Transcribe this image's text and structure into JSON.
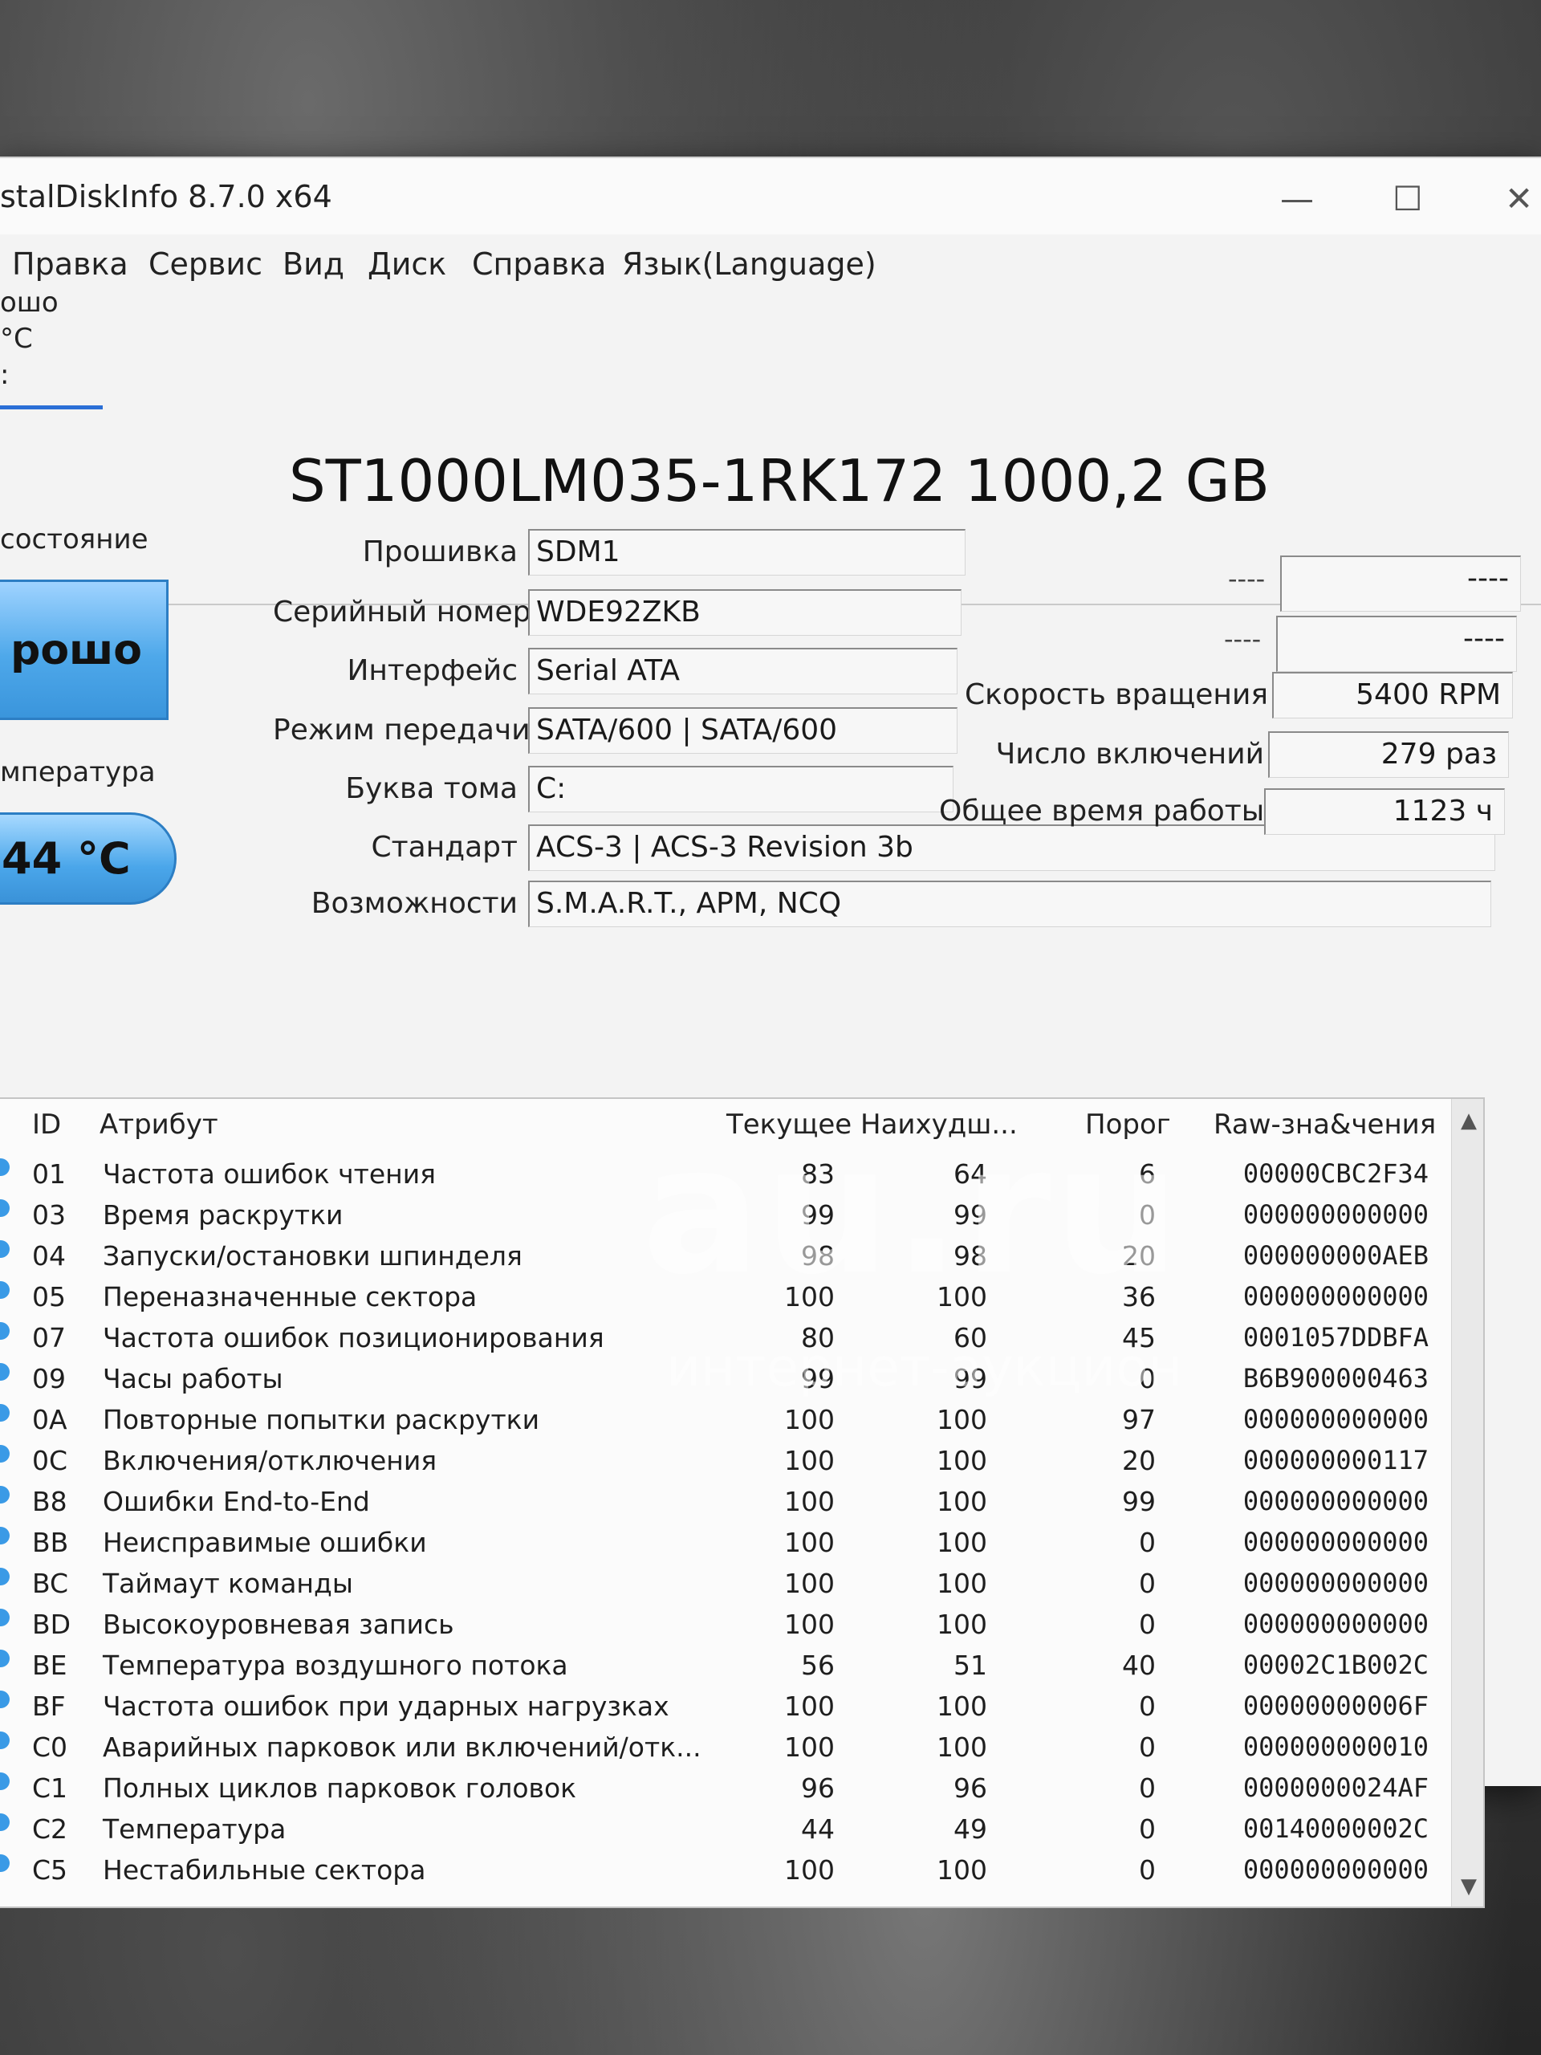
{
  "window": {
    "title": "stalDiskInfo 8.7.0 x64",
    "minimize": "—",
    "maximize": "☐",
    "close": "✕"
  },
  "menu": [
    "Правка",
    "Сервис",
    "Вид",
    "Диск",
    "Справка",
    "Язык(Language)"
  ],
  "left_panel": {
    "tab_line1": "ошо",
    "tab_line2": "°C",
    "tab_line3": ":",
    "health_label": "состояние",
    "health_value": "рошо",
    "temp_label": "мпература",
    "temp_value": "44 °C"
  },
  "disk": {
    "model": "ST1000LM035-1RK172 1000,2 GB",
    "firmware_label": "Прошивка",
    "firmware": "SDM1",
    "serial_label": "Серийный номер",
    "serial": "WDE92ZKB",
    "interface_label": "Интерфейс",
    "interface": "Serial ATA",
    "transfer_label": "Режим передачи",
    "transfer": "SATA/600 | SATA/600",
    "drive_letter_label": "Буква тома",
    "drive_letter": "C:",
    "standard_label": "Стандарт",
    "standard": "ACS-3 | ACS-3 Revision 3b",
    "features_label": "Возможности",
    "features": "S.M.A.R.T., APM, NCQ",
    "blank1_left": "----",
    "blank1_right": "----",
    "blank2_left": "----",
    "blank2_right": "----",
    "rotation_label": "Скорость вращения",
    "rotation": "5400 RPM",
    "power_count_label": "Число включений",
    "power_count": "279 раз",
    "power_hours_label": "Общее время работы",
    "power_hours": "1123 ч"
  },
  "table": {
    "headers": {
      "id": "ID",
      "attr": "Атрибут",
      "current": "Текущее",
      "worst": "Наихудш...",
      "threshold": "Порог",
      "raw": "Raw-зна&чения"
    },
    "rows": [
      {
        "id": "01",
        "name": "Частота ошибок чтения",
        "current": "83",
        "worst": "64",
        "threshold": "6",
        "raw": "00000CBC2F34"
      },
      {
        "id": "03",
        "name": "Время раскрутки",
        "current": "99",
        "worst": "99",
        "threshold": "0",
        "raw": "000000000000"
      },
      {
        "id": "04",
        "name": "Запуски/остановки шпинделя",
        "current": "98",
        "worst": "98",
        "threshold": "20",
        "raw": "000000000AEB"
      },
      {
        "id": "05",
        "name": "Переназначенные сектора",
        "current": "100",
        "worst": "100",
        "threshold": "36",
        "raw": "000000000000"
      },
      {
        "id": "07",
        "name": "Частота ошибок позиционирования",
        "current": "80",
        "worst": "60",
        "threshold": "45",
        "raw": "0001057DDBFA"
      },
      {
        "id": "09",
        "name": "Часы работы",
        "current": "99",
        "worst": "99",
        "threshold": "0",
        "raw": "B6B900000463"
      },
      {
        "id": "0A",
        "name": "Повторные попытки раскрутки",
        "current": "100",
        "worst": "100",
        "threshold": "97",
        "raw": "000000000000"
      },
      {
        "id": "0C",
        "name": "Включения/отключения",
        "current": "100",
        "worst": "100",
        "threshold": "20",
        "raw": "000000000117"
      },
      {
        "id": "B8",
        "name": "Ошибки End-to-End",
        "current": "100",
        "worst": "100",
        "threshold": "99",
        "raw": "000000000000"
      },
      {
        "id": "BB",
        "name": "Неисправимые ошибки",
        "current": "100",
        "worst": "100",
        "threshold": "0",
        "raw": "000000000000"
      },
      {
        "id": "BC",
        "name": "Таймаут команды",
        "current": "100",
        "worst": "100",
        "threshold": "0",
        "raw": "000000000000"
      },
      {
        "id": "BD",
        "name": "Высокоуровневая запись",
        "current": "100",
        "worst": "100",
        "threshold": "0",
        "raw": "000000000000"
      },
      {
        "id": "BE",
        "name": "Температура воздушного потока",
        "current": "56",
        "worst": "51",
        "threshold": "40",
        "raw": "00002C1B002C"
      },
      {
        "id": "BF",
        "name": "Частота ошибок при ударных нагрузках",
        "current": "100",
        "worst": "100",
        "threshold": "0",
        "raw": "00000000006F"
      },
      {
        "id": "C0",
        "name": "Аварийных парковок или включений/отк...",
        "current": "100",
        "worst": "100",
        "threshold": "0",
        "raw": "000000000010"
      },
      {
        "id": "C1",
        "name": "Полных циклов парковок головок",
        "current": "96",
        "worst": "96",
        "threshold": "0",
        "raw": "0000000024AF"
      },
      {
        "id": "C2",
        "name": "Температура",
        "current": "44",
        "worst": "49",
        "threshold": "0",
        "raw": "00140000002C"
      },
      {
        "id": "C5",
        "name": "Нестабильные сектора",
        "current": "100",
        "worst": "100",
        "threshold": "0",
        "raw": "000000000000"
      }
    ]
  },
  "watermark": {
    "main": "au.ru",
    "sub": "интернет-аукцион"
  }
}
